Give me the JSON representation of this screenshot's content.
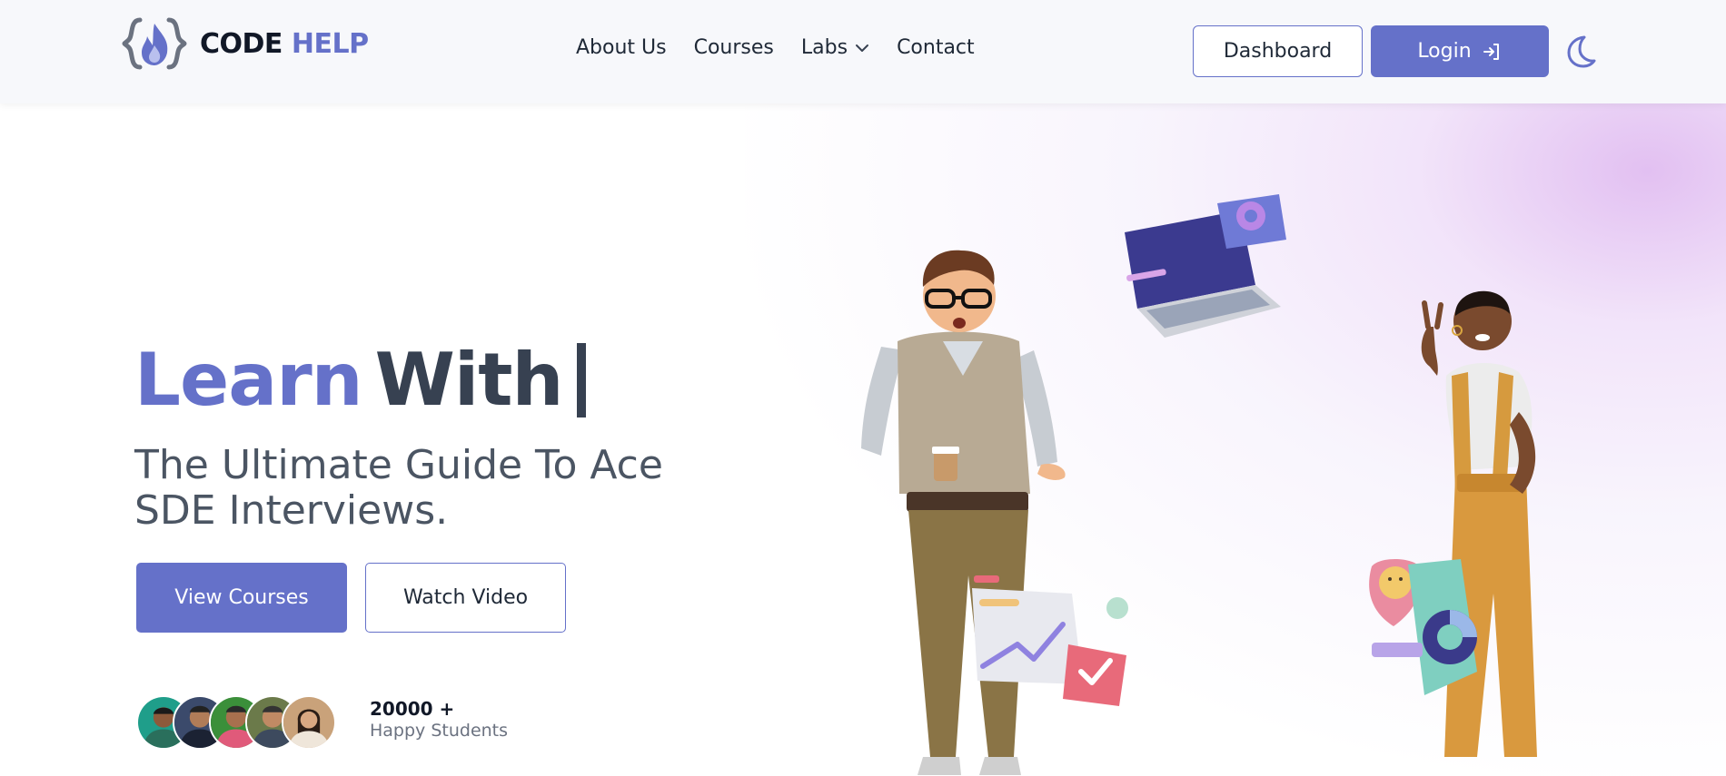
{
  "brand": {
    "name_part1": "CODE",
    "name_part2": "HELP"
  },
  "nav": {
    "items": [
      {
        "label": "About Us"
      },
      {
        "label": "Courses"
      },
      {
        "label": "Labs"
      },
      {
        "label": "Contact"
      }
    ],
    "dashboard_label": "Dashboard",
    "login_label": "Login"
  },
  "hero": {
    "title_accent": "Learn",
    "title_main": "With",
    "subtitle": "The Ultimate Guide To Ace SDE Interviews.",
    "primary_cta": "View Courses",
    "secondary_cta": "Watch Video",
    "students_count": "20000 +",
    "students_label": "Happy Students"
  },
  "colors": {
    "accent": "#6571c9",
    "text_dark": "#374151",
    "nav_bg": "#f7f8fb"
  },
  "icons": [
    "logo-flame-icon",
    "chevron-down-icon",
    "login-arrow-icon",
    "moon-icon"
  ]
}
